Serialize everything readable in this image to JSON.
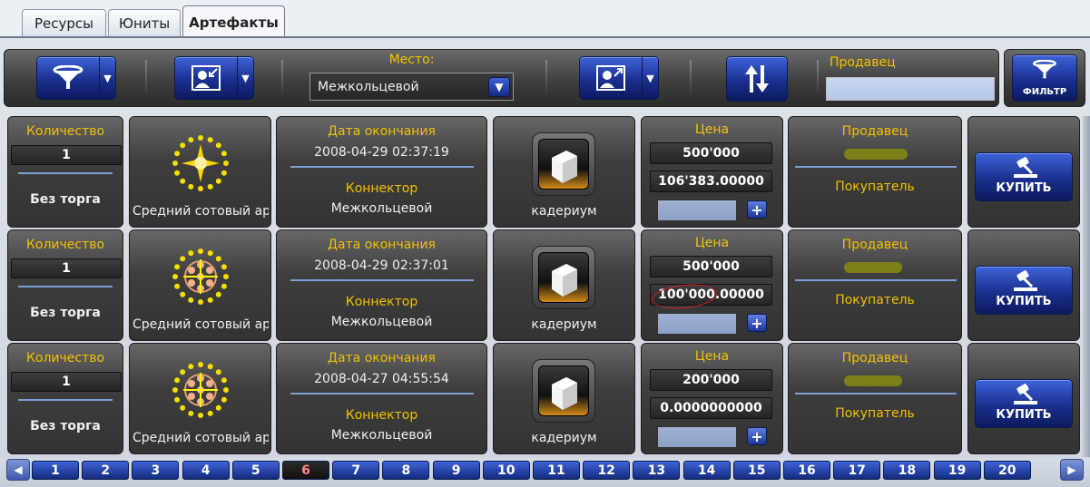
{
  "tabs": [
    {
      "label": "Ресурсы"
    },
    {
      "label": "Юниты"
    },
    {
      "label": "Артефакты",
      "active": true
    }
  ],
  "toolbar": {
    "place_label": "Место:",
    "place_value": "Межкольцевой",
    "seller_label": "Продавец",
    "seller_value": "",
    "filter_label": "ФИЛЬТР"
  },
  "rows": [
    {
      "qty_label": "Количество",
      "qty": "1",
      "trade": "Без торга",
      "item_name": "Средний сотовый арт",
      "end_label": "Дата окончания",
      "end_date": "2008-04-29 02:37:19",
      "connector_label": "Коннектор",
      "connector": "Межкольцевой",
      "resource": "кадериум",
      "price_label": "Цена",
      "price_buyout": "500'000",
      "price_bid": "106'383.00000",
      "seller_label": "Продавец",
      "buyer_label": "Покупатель",
      "buy_label": "КУПИТЬ"
    },
    {
      "qty_label": "Количество",
      "qty": "1",
      "trade": "Без торга",
      "item_name": "Средний сотовый арт",
      "end_label": "Дата окончания",
      "end_date": "2008-04-29 02:37:01",
      "connector_label": "Коннектор",
      "connector": "Межкольцевой",
      "resource": "кадериум",
      "price_label": "Цена",
      "price_buyout": "500'000",
      "price_bid": "100'000.00000",
      "seller_label": "Продавец",
      "buyer_label": "Покупатель",
      "buy_label": "КУПИТЬ"
    },
    {
      "qty_label": "Количество",
      "qty": "1",
      "trade": "Без торга",
      "item_name": "Средний сотовый арт",
      "end_label": "Дата окончания",
      "end_date": "2008-04-27 04:55:54",
      "connector_label": "Коннектор",
      "connector": "Межкольцевой",
      "resource": "кадериум",
      "price_label": "Цена",
      "price_buyout": "200'000",
      "price_bid": "0.0000000000",
      "seller_label": "Продавец",
      "buyer_label": "Покупатель",
      "buy_label": "КУПИТЬ"
    }
  ],
  "pagination": {
    "pages": [
      "1",
      "2",
      "3",
      "4",
      "5",
      "6",
      "7",
      "8",
      "9",
      "10",
      "11",
      "12",
      "13",
      "14",
      "15",
      "16",
      "17",
      "18",
      "19",
      "20"
    ],
    "current": "6"
  },
  "icons": {
    "filter": "funnel-icon",
    "user_in": "user-arrow-in-icon",
    "user_out": "user-arrow-out-icon",
    "sort": "sort-arrows-icon",
    "buy": "gavel-icon",
    "artifact": "cellular-artifact-icon",
    "resource": "cube-icon"
  },
  "colors": {
    "accent_yellow": "#f2c200",
    "button_blue": "#1a2f8f",
    "panel_dark": "#3e3e3e"
  }
}
